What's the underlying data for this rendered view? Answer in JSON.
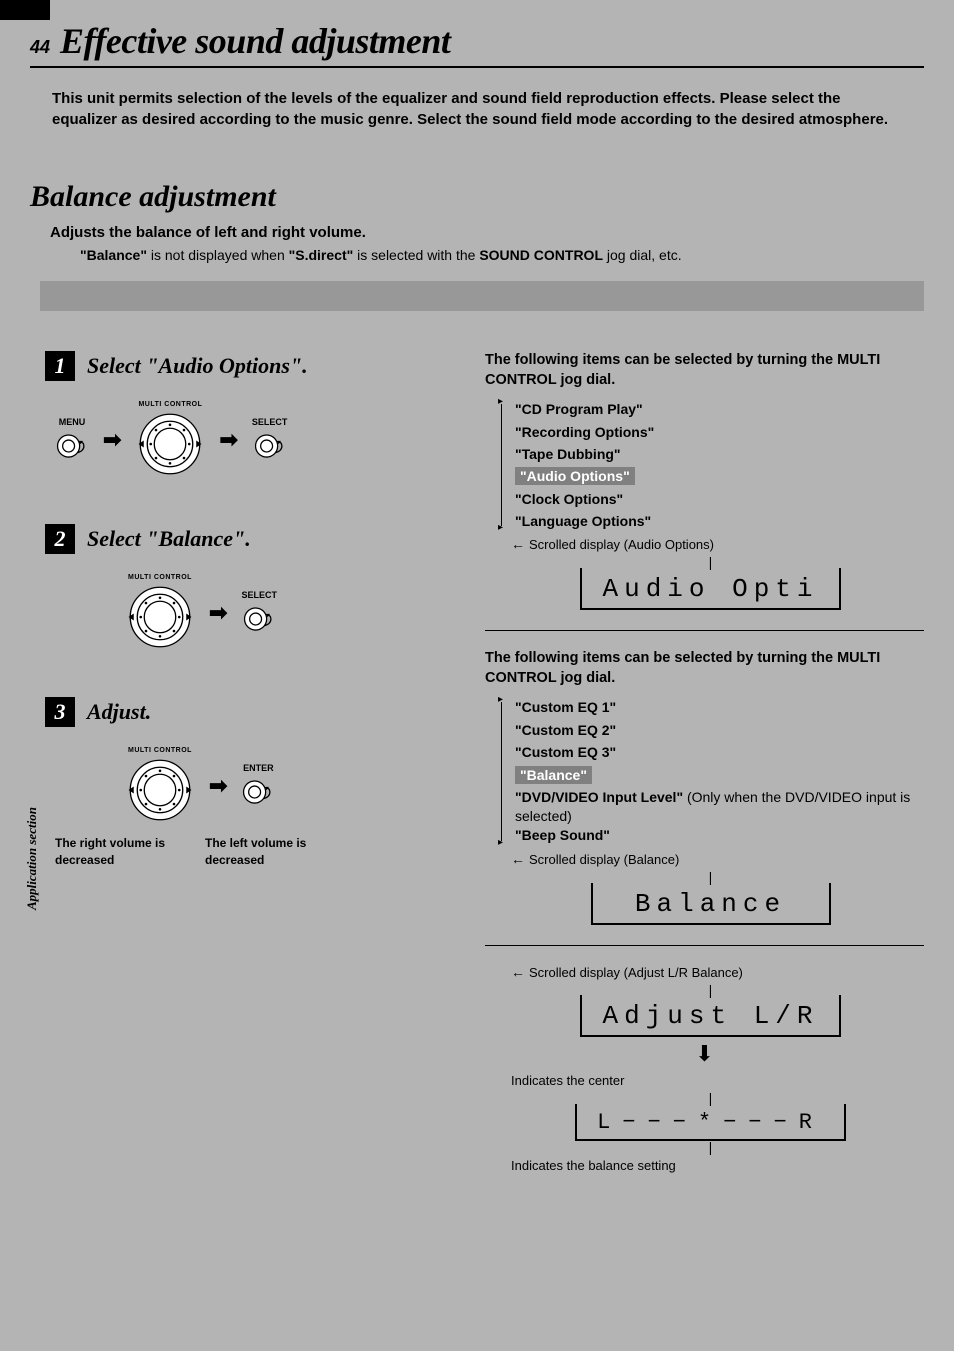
{
  "page_number": "44",
  "page_title": "Effective sound adjustment",
  "intro": "This unit permits selection of the levels of the equalizer and sound field reproduction effects. Please select the equalizer as desired according to the music genre. Select the sound field mode according to the desired atmosphere.",
  "section_title": "Balance adjustment",
  "section_desc": "Adjusts the balance of left and right volume.",
  "section_note_quote": "\"Balance\"",
  "section_note_mid": " is not displayed when ",
  "section_note_quote2": "\"S.direct\"",
  "section_note_mid2": " is selected with the ",
  "section_note_bold": "SOUND CONTROL",
  "section_note_end": " jog dial, etc.",
  "side_label": "Application section",
  "labels": {
    "menu": "MENU",
    "multi_control": "MULTI CONTROL",
    "select": "SELECT",
    "enter": "ENTER"
  },
  "steps": {
    "s1": {
      "num": "1",
      "title": "Select \"Audio Options\"."
    },
    "s2": {
      "num": "2",
      "title": "Select \"Balance\"."
    },
    "s3": {
      "num": "3",
      "title": "Adjust."
    }
  },
  "vol": {
    "right": "The right volume is decreased",
    "left": "The left volume is decreased"
  },
  "right1": {
    "intro": "The following items can be selected by turning the MULTI CONTROL jog dial.",
    "options": [
      "\"CD Program Play\"",
      "\"Recording Options\"",
      "\"Tape Dubbing\"",
      "\"Audio Options\"",
      "\"Clock Options\"",
      "\"Language Options\""
    ],
    "highlight_index": 3,
    "scrolled": "Scrolled display (Audio Options)",
    "lcd": "Audio Opti"
  },
  "right2": {
    "intro": "The following items can be selected by turning the MULTI CONTROL jog dial.",
    "options": [
      "\"Custom EQ 1\"",
      "\"Custom EQ 2\"",
      "\"Custom EQ 3\"",
      "\"Balance\"",
      "\"DVD/VIDEO Input Level\"",
      "\"Beep Sound\""
    ],
    "option_dvd_note": " (Only when the DVD/VIDEO input is selected)",
    "highlight_index": 3,
    "scrolled": "Scrolled display (Balance)",
    "lcd": "Balance"
  },
  "right3": {
    "scrolled": "Scrolled display (Adjust L/R Balance)",
    "lcd": "Adjust L/R",
    "indicates_center": "Indicates the center",
    "balance_lcd": "L−−−*−−−R",
    "indicates_setting": "Indicates the balance setting"
  }
}
